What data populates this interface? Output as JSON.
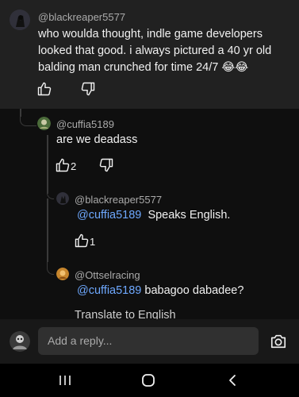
{
  "comments": [
    {
      "handle": "@blackreaper5577",
      "lines": [
        "who woulda thought, indle game developers",
        "looked that good. i always pictured a 40 yr old",
        "balding man crunched for time 24/7 😂😂"
      ]
    },
    {
      "handle": "@cuffia5189",
      "text": "are we deadass",
      "likes": "2"
    },
    {
      "handle": "@blackreaper5577",
      "mention": "@cuffia5189",
      "text": "Speaks English.",
      "likes": "1"
    },
    {
      "handle": "@Ottselracing",
      "mention": "@cuffia5189",
      "text": "babagoo dabadee?",
      "translate": "Translate to English"
    }
  ],
  "reply": {
    "placeholder": "Add a reply..."
  },
  "icons": {
    "like": "thumbs-up-icon",
    "dislike": "thumbs-down-icon",
    "camera": "camera-icon",
    "nav_recents": "recent-apps-icon",
    "nav_home": "home-icon",
    "nav_back": "back-icon"
  }
}
